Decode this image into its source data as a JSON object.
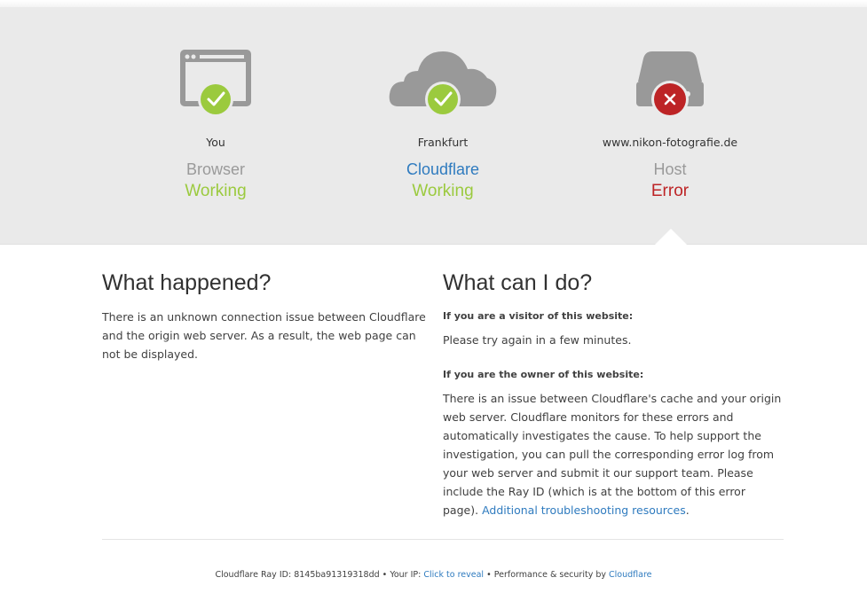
{
  "nodes": [
    {
      "location": "You",
      "name": "Browser",
      "status": "Working",
      "state": "ok",
      "icon": "browser-icon"
    },
    {
      "location": "Frankfurt",
      "name": "Cloudflare",
      "status": "Working",
      "state": "ok",
      "icon": "cloud-icon"
    },
    {
      "location": "www.nikon-fotografie.de",
      "name": "Host",
      "status": "Error",
      "state": "error",
      "icon": "server-icon"
    }
  ],
  "what_happened": {
    "title": "What happened?",
    "text": "There is an unknown connection issue between Cloudflare and the origin web server. As a result, the web page can not be displayed."
  },
  "what_can_i_do": {
    "title": "What can I do?",
    "visitor_heading": "If you are a visitor of this website:",
    "visitor_text": "Please try again in a few minutes.",
    "owner_heading": "If you are the owner of this website:",
    "owner_text": "There is an issue between Cloudflare's cache and your origin web server. Cloudflare monitors for these errors and automatically investigates the cause. To help support the investigation, you can pull the corresponding error log from your web server and submit it our support team. Please include the Ray ID (which is at the bottom of this error page).",
    "owner_link": "Additional troubleshooting resources",
    "owner_end": "."
  },
  "footer": {
    "ray_label": "Cloudflare Ray ID:",
    "ray_id": "8145ba91319318dd",
    "sep": "•",
    "ip_label": "Your IP:",
    "ip_link": "Click to reveal",
    "perf_label": "Performance & security by",
    "perf_link": "Cloudflare"
  },
  "colors": {
    "ok": "#9bca3e",
    "error": "#bd2426",
    "link": "#2f7bbf",
    "icon_gray": "#999999"
  }
}
